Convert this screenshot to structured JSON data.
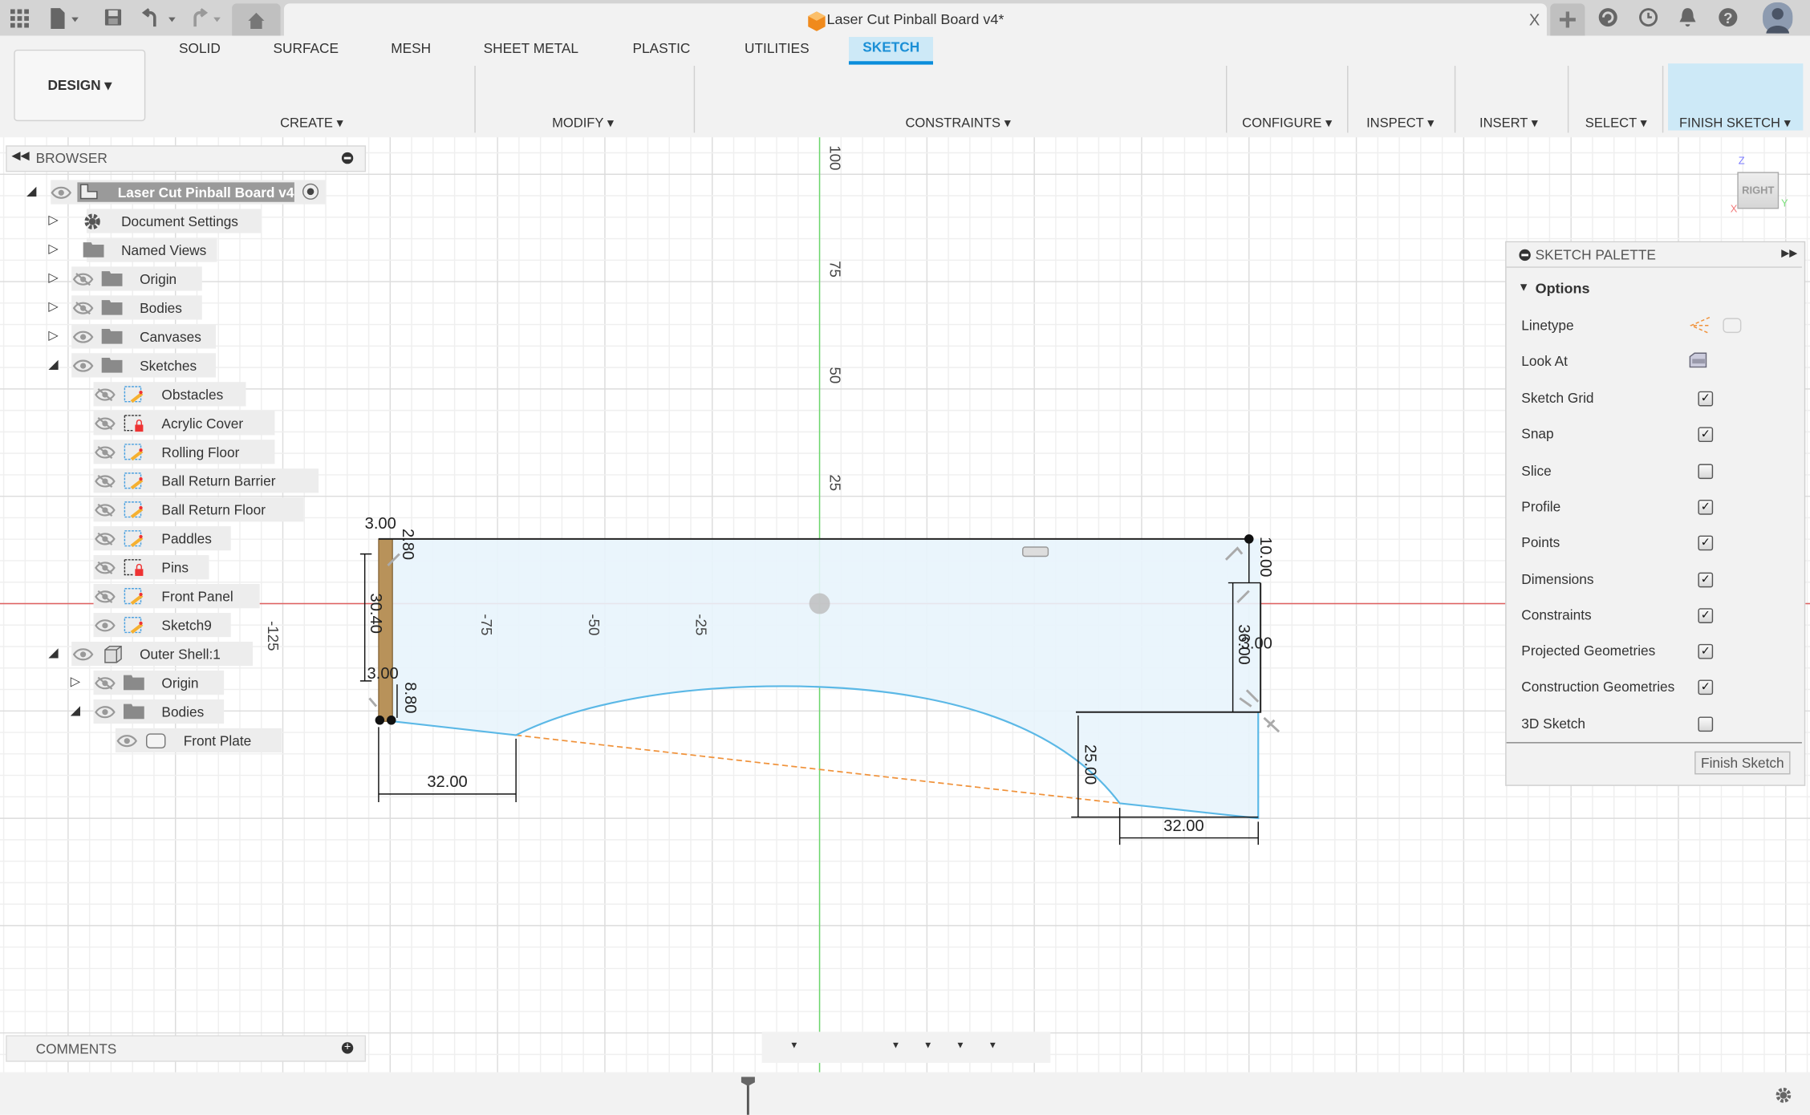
{
  "app": {
    "document_title": "Laser Cut Pinball Board v4*",
    "close_tab": "X"
  },
  "ribbon": {
    "workspace": "DESIGN ▾",
    "tabs": [
      "SOLID",
      "SURFACE",
      "MESH",
      "SHEET METAL",
      "PLASTIC",
      "UTILITIES",
      "SKETCH"
    ],
    "active_tab": "SKETCH",
    "groups": [
      "CREATE ▾",
      "MODIFY ▾",
      "CONSTRAINTS ▾",
      "CONFIGURE ▾",
      "INSPECT ▾",
      "INSERT ▾",
      "SELECT ▾",
      "FINISH SKETCH ▾"
    ],
    "accent": "#0a8ddb"
  },
  "browser": {
    "title": "BROWSER",
    "items": [
      {
        "label": "Laser Cut Pinball Board v4",
        "level": 0,
        "expander": "open",
        "eye": "visible",
        "icon": "component-icon",
        "root": true
      },
      {
        "label": "Document Settings",
        "level": 1,
        "expander": "closed",
        "eye": "none",
        "icon": "gear-icon"
      },
      {
        "label": "Named Views",
        "level": 1,
        "expander": "closed",
        "eye": "none",
        "icon": "folder-icon"
      },
      {
        "label": "Origin",
        "level": 1,
        "expander": "closed",
        "eye": "hidden",
        "icon": "folder-icon"
      },
      {
        "label": "Bodies",
        "level": 1,
        "expander": "closed",
        "eye": "hidden",
        "icon": "folder-icon"
      },
      {
        "label": "Canvases",
        "level": 1,
        "expander": "closed",
        "eye": "visible",
        "icon": "folder-icon"
      },
      {
        "label": "Sketches",
        "level": 1,
        "expander": "open",
        "eye": "visible",
        "icon": "folder-icon"
      },
      {
        "label": "Obstacles",
        "level": 2,
        "expander": "none",
        "eye": "hidden",
        "icon": "sketch-icon"
      },
      {
        "label": "Acrylic Cover",
        "level": 2,
        "expander": "none",
        "eye": "hidden",
        "icon": "sketch-locked-icon"
      },
      {
        "label": "Rolling Floor",
        "level": 2,
        "expander": "none",
        "eye": "hidden",
        "icon": "sketch-icon"
      },
      {
        "label": "Ball Return Barrier",
        "level": 2,
        "expander": "none",
        "eye": "hidden",
        "icon": "sketch-icon"
      },
      {
        "label": "Ball Return Floor",
        "level": 2,
        "expander": "none",
        "eye": "hidden",
        "icon": "sketch-icon"
      },
      {
        "label": "Paddles",
        "level": 2,
        "expander": "none",
        "eye": "hidden",
        "icon": "sketch-icon"
      },
      {
        "label": "Pins",
        "level": 2,
        "expander": "none",
        "eye": "hidden",
        "icon": "sketch-locked-icon"
      },
      {
        "label": "Front Panel",
        "level": 2,
        "expander": "none",
        "eye": "hidden",
        "icon": "sketch-icon"
      },
      {
        "label": "Sketch9",
        "level": 2,
        "expander": "none",
        "eye": "visible",
        "icon": "sketch-icon"
      },
      {
        "label": "Outer Shell:1",
        "level": 1,
        "expander": "open",
        "eye": "visible",
        "icon": "body-icon"
      },
      {
        "label": "Origin",
        "level": 2,
        "expander": "closed",
        "eye": "hidden",
        "icon": "folder-icon"
      },
      {
        "label": "Bodies",
        "level": 2,
        "expander": "open",
        "eye": "visible",
        "icon": "folder-icon"
      },
      {
        "label": "Front Plate",
        "level": 3,
        "expander": "none",
        "eye": "visible",
        "icon": "solid-body-icon"
      }
    ]
  },
  "comments": {
    "title": "COMMENTS"
  },
  "palette": {
    "title": "SKETCH PALETTE",
    "section": "Options",
    "linetype_label": "Linetype",
    "lookat_label": "Look At",
    "options": [
      {
        "label": "Sketch Grid",
        "checked": true
      },
      {
        "label": "Snap",
        "checked": true
      },
      {
        "label": "Slice",
        "checked": false
      },
      {
        "label": "Profile",
        "checked": true
      },
      {
        "label": "Points",
        "checked": true
      },
      {
        "label": "Dimensions",
        "checked": true
      },
      {
        "label": "Constraints",
        "checked": true
      },
      {
        "label": "Projected Geometries",
        "checked": true
      },
      {
        "label": "Construction Geometries",
        "checked": true
      },
      {
        "label": "3D Sketch",
        "checked": false
      }
    ],
    "finish_button": "Finish Sketch"
  },
  "viewcube": {
    "face": "RIGHT",
    "z": "Z",
    "y": "Y",
    "x": "X"
  },
  "sketch": {
    "axis_labels": [
      "100",
      "75",
      "50",
      "25",
      "-75",
      "-50",
      "-25",
      "-125"
    ],
    "dimensions": [
      "3.00",
      "2.80",
      "30.40",
      "3.00",
      "8.80",
      "32.00",
      "10.00",
      "36.00",
      "3.00",
      "25.00",
      "32.00"
    ],
    "colors": {
      "profile_fill": "#e8f4fc",
      "curve": "#5bb8e6",
      "construction": "#f0923a",
      "x_axis": "#e06060",
      "y_axis": "#6ad66a"
    }
  },
  "timeline": {
    "items": [
      "canvas",
      "sketch",
      "extrude",
      "sketch",
      "extrude",
      "sketch",
      "extrude",
      "sketch",
      "sketch",
      "extrude",
      "extrude",
      "extrude",
      "sketch",
      "extrude",
      "sketch",
      "extrude",
      "sketch",
      "new-body",
      "extrude",
      "sketch"
    ]
  }
}
